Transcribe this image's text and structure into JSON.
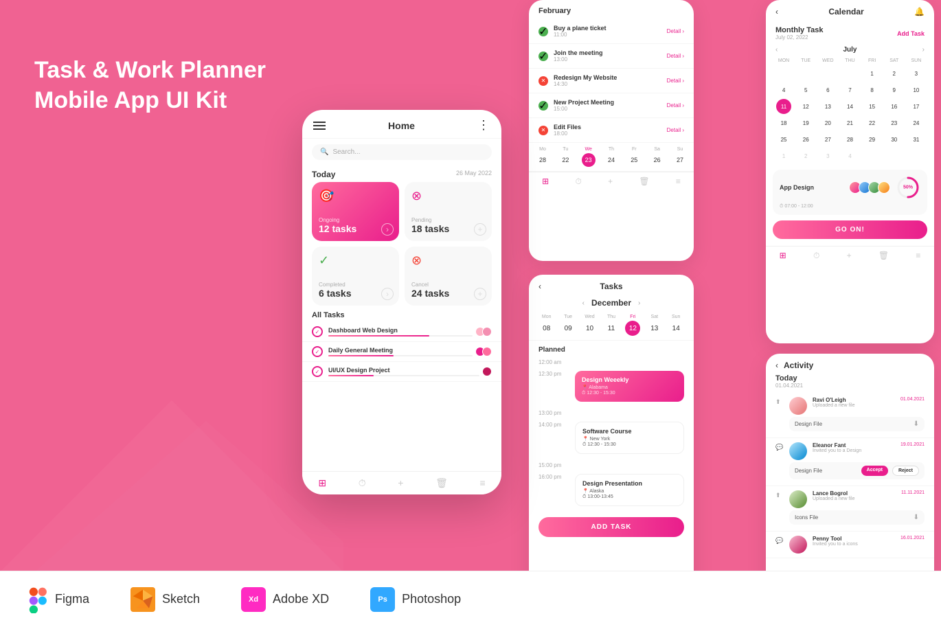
{
  "heading": {
    "line1": "Task & Work Planner",
    "line2": "Mobile App UI Kit"
  },
  "tools": [
    {
      "name": "figma",
      "label": "Figma",
      "color": "#1e1e1e"
    },
    {
      "name": "sketch",
      "label": "Sketch",
      "color": "#f7931e"
    },
    {
      "name": "adobexd",
      "label": "Adobe XD",
      "color": "#ff2bc2"
    },
    {
      "name": "photoshop",
      "label": "Photoshop",
      "color": "#31a8ff"
    }
  ],
  "phone": {
    "title": "Home",
    "search_placeholder": "Search...",
    "today_label": "Today",
    "today_date": "26 May 2022",
    "ongoing_label": "Ongoing",
    "ongoing_count": "12 tasks",
    "pending_label": "Pending",
    "pending_count": "18 tasks",
    "completed_label": "Completed",
    "completed_count": "6 tasks",
    "cancel_label": "Cancel",
    "cancel_count": "24 tasks",
    "all_tasks_label": "All Tasks",
    "tasks": [
      {
        "name": "Dashboard Web Design",
        "progress": 70
      },
      {
        "name": "Daily General Meeting",
        "progress": 45
      },
      {
        "name": "UI/UX Design Project",
        "progress": 30
      }
    ]
  },
  "tasks_list_screen": {
    "month": "February",
    "items": [
      {
        "name": "Buy a plane ticket",
        "time": "11:00",
        "status": "done"
      },
      {
        "name": "Join the meeting",
        "time": "13:00",
        "status": "done"
      },
      {
        "name": "Redesign My Website",
        "time": "14:30",
        "status": "cancel"
      },
      {
        "name": "New Project Meeting",
        "time": "15:00",
        "status": "done"
      },
      {
        "name": "Edit Files",
        "time": "18:00",
        "status": "cancel"
      }
    ]
  },
  "calendar_screen": {
    "title": "Calendar",
    "monthly_task_label": "Monthly Task",
    "monthly_task_date": "July 02, 2022",
    "add_task_label": "Add Task",
    "month": "July",
    "days_header": [
      "MON",
      "TUE",
      "WED",
      "THU",
      "FRI",
      "SAT",
      "SUN"
    ],
    "days": [
      "",
      "",
      "",
      "",
      "1",
      "2",
      "3",
      "4",
      "5",
      "6",
      "7",
      "8",
      "9",
      "10",
      "11",
      "12",
      "13",
      "14",
      "15",
      "16",
      "17",
      "18",
      "19",
      "20",
      "21",
      "22",
      "23",
      "24",
      "25",
      "26",
      "27",
      "28",
      "29",
      "30",
      "31",
      "1",
      "2",
      "3",
      "4"
    ],
    "today_day": "11",
    "week_days": [
      "Mo",
      "Tu",
      "We",
      "Th",
      "Fr",
      "Sa",
      "Su"
    ],
    "week_dates": [
      "28",
      "22",
      "23",
      "24",
      "25",
      "26",
      "27"
    ],
    "active_week_day": "We",
    "app_design_label": "App Design",
    "progress_percent": "50%",
    "time_range": "07:00 - 12:00",
    "go_btn": "GO ON!"
  },
  "tasks_detail_screen": {
    "title": "Tasks",
    "month": "December",
    "week_days": [
      "Mon",
      "Tue",
      "Wed",
      "Thu",
      "Fri",
      "Sat",
      "Sun"
    ],
    "week_dates": [
      "08",
      "09",
      "10",
      "11",
      "12",
      "13",
      "14"
    ],
    "active_date": "12",
    "planned_label": "Planned",
    "time_slots": [
      {
        "time": "12:00 am",
        "event": null
      },
      {
        "time": "12:30 pm",
        "event": {
          "name": "Design Weeekly",
          "location": "Alabama",
          "time_range": "12:30 - 15:30",
          "type": "pink"
        }
      },
      {
        "time": "13:00 pm",
        "event": null
      },
      {
        "time": "14:00 pm",
        "event": {
          "name": "Software Course",
          "location": "New York",
          "time_range": "12:30 - 15:30",
          "type": "white"
        }
      },
      {
        "time": "15:00 pm",
        "event": null
      },
      {
        "time": "16:00 pm",
        "event": {
          "name": "Design Presentation",
          "location": "Alaska",
          "time_range": "13:00-13:45",
          "type": "white"
        }
      }
    ],
    "add_task_btn": "ADD TASK"
  },
  "activity_screen": {
    "title": "Activity",
    "today_label": "Today",
    "today_date": "01.04.2021",
    "items": [
      {
        "name": "Ravi O'Leigh",
        "date": "01.04.2021",
        "action": "Uploaded a new file",
        "file": "Design File",
        "has_download": true
      },
      {
        "name": "Eleanor Fant",
        "date": "19.01.2021",
        "action": "Invited you to a Design",
        "file": "Design File",
        "has_actions": true,
        "accept_label": "Accept",
        "reject_label": "Reject"
      },
      {
        "name": "Lance Bogrol",
        "date": "11.11.2021",
        "action": "Uploaded a new file",
        "file": "Icons File",
        "has_download": true
      },
      {
        "name": "Penny Tool",
        "date": "16.01.2021",
        "action": "Invited you to a icons",
        "file": null,
        "has_download": false
      }
    ]
  }
}
